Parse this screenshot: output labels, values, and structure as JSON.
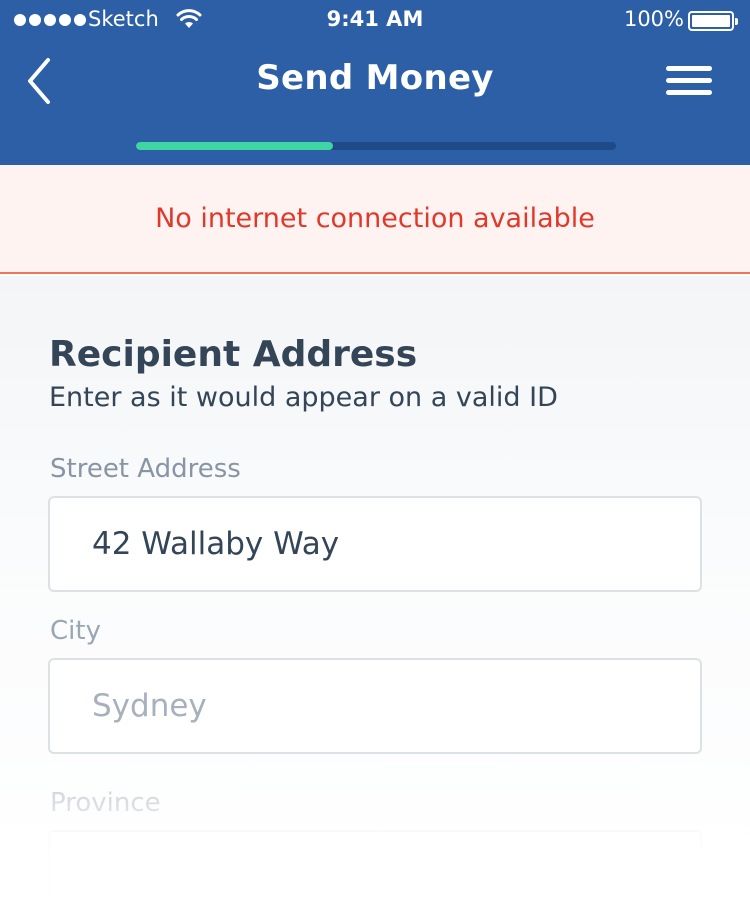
{
  "status_bar": {
    "carrier": "Sketch",
    "time": "9:41 AM",
    "battery_percent": "100%",
    "battery_level": 1.0
  },
  "nav": {
    "title": "Send Money",
    "back_icon": "chevron-left-icon",
    "menu_icon": "hamburger-menu-icon"
  },
  "progress": {
    "fraction": 0.41,
    "fill_color": "#3FD6A4",
    "track_color": "#1F4A88"
  },
  "banner": {
    "message": "No internet connection available",
    "text_color": "#E0392B",
    "background_color": "#FFF3F1"
  },
  "form": {
    "title": "Recipient Address",
    "subtitle": "Enter as it would appear on a valid ID",
    "fields": [
      {
        "label": "Street Address",
        "value": "42 Wallaby Way",
        "placeholder": ""
      },
      {
        "label": "City",
        "value": "",
        "placeholder": "Sydney"
      },
      {
        "label": "Province",
        "value": "",
        "placeholder": ""
      }
    ]
  },
  "colors": {
    "header": "#2C5FA6",
    "heading_text": "#344557",
    "label_text": "#8795A6"
  }
}
